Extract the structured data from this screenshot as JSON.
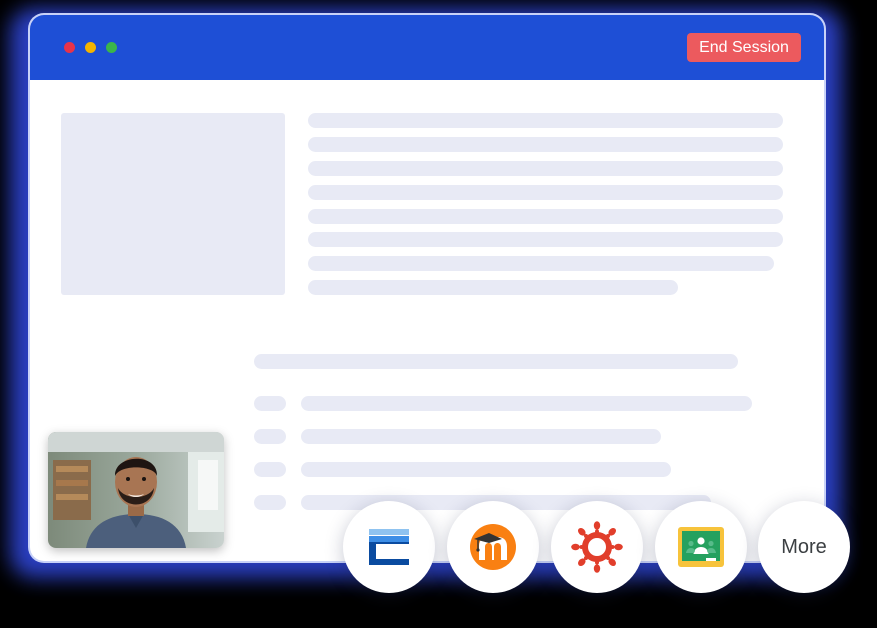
{
  "window": {
    "traffic_lights": [
      {
        "name": "close",
        "color": "#e8334a"
      },
      {
        "name": "minimize",
        "color": "#f4b400"
      },
      {
        "name": "zoom",
        "color": "#3bb54a"
      }
    ],
    "title_bar_color": "#1e4fd6",
    "end_session": {
      "label": "End Session",
      "color": "#ec5a5e"
    }
  },
  "integrations": [
    {
      "name": "blackboard",
      "icon": "blackboard-icon"
    },
    {
      "name": "moodle",
      "icon": "moodle-icon"
    },
    {
      "name": "canvas",
      "icon": "canvas-icon"
    },
    {
      "name": "google-classroom",
      "icon": "google-classroom-icon"
    },
    {
      "name": "more",
      "label": "More"
    }
  ],
  "video_tile": {
    "icon": "user-video-avatar"
  }
}
